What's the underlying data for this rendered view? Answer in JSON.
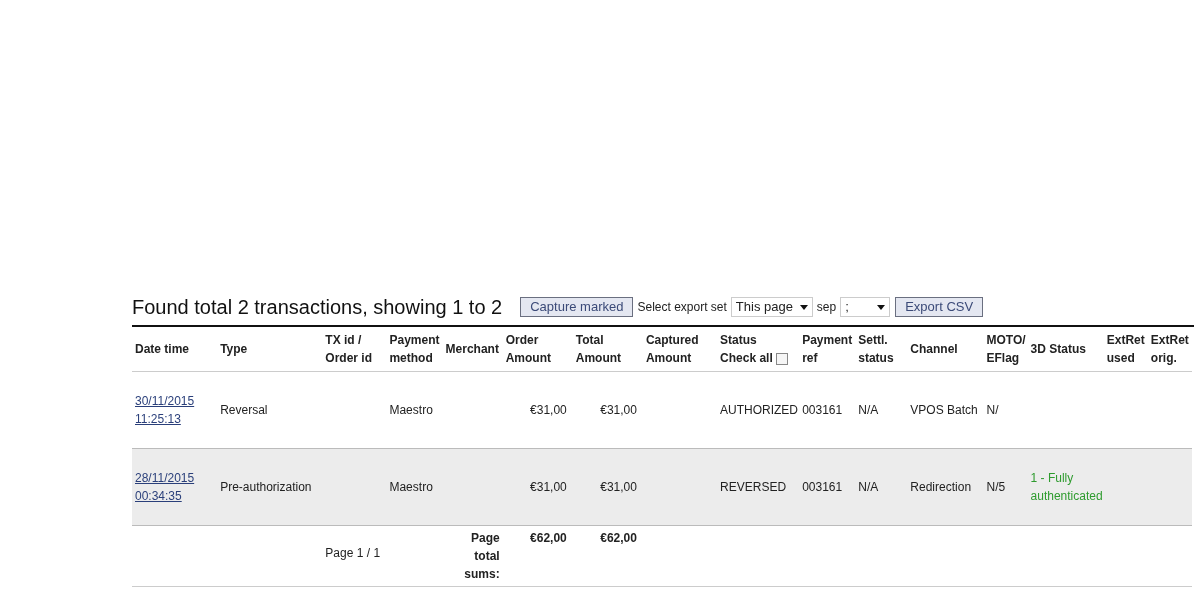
{
  "title": "Found total 2 transactions, showing 1 to 2",
  "toolbar": {
    "capture_button": "Capture marked",
    "export_label": "Select export set",
    "export_set": "This page",
    "sep_label": "sep",
    "sep_value": ";",
    "export_button": "Export CSV"
  },
  "table": {
    "columns": [
      "Date time",
      "Type",
      "TX id / Order id",
      "Payment method",
      "Merchant",
      "Order Amount",
      "Total Amount",
      "Captured Amount",
      "Status",
      "Payment ref",
      "Settl. status",
      "Channel",
      "MOTO/ EFlag",
      "3D Status",
      "ExtRet used",
      "ExtRet orig."
    ],
    "check_all": {
      "label": "Check all",
      "checked": false
    },
    "rows": [
      {
        "date_time": "30/11/2015 11:25:13",
        "type": "Reversal",
        "payment_method": "Maestro",
        "order_amount": "€31,00",
        "total_amount": "€31,00",
        "status": "AUTHORIZED",
        "payment_ref": "003161",
        "settl_status": "N/A",
        "channel": "VPOS Batch",
        "moto_eflag": "N/",
        "three_d_status": ""
      },
      {
        "date_time": "28/11/2015 00:34:35",
        "type": "Pre-authorization",
        "payment_method": "Maestro",
        "order_amount": "€31,00",
        "total_amount": "€31,00",
        "status": "REVERSED",
        "payment_ref": "003161",
        "settl_status": "N/A",
        "channel": "Redirection",
        "moto_eflag": "N/5",
        "three_d_status": "1 - Fully authenticated"
      }
    ],
    "footer": {
      "page": "Page 1 / 1",
      "sums_label": "Page total sums:",
      "order_sum": "€62,00",
      "total_sum": "€62,00"
    }
  }
}
